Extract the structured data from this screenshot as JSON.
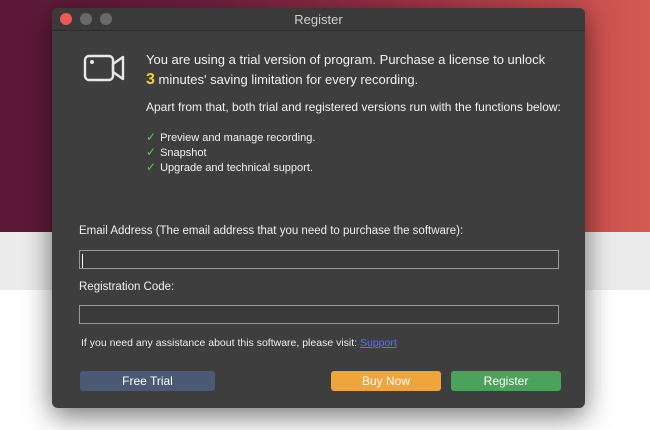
{
  "window": {
    "title": "Register"
  },
  "message": {
    "part1": "You are using a trial version of program. Purchase a license to unlock",
    "highlight": "3",
    "part2": " minutes' saving limitation for every recording."
  },
  "apart_text": "Apart from that, both trial and registered versions run with the functions below:",
  "features": [
    "Preview and manage recording.",
    "Snapshot",
    "Upgrade and technical support."
  ],
  "email": {
    "label": "Email Address (The email address that you need to purchase the software):",
    "value": "",
    "placeholder": ""
  },
  "code": {
    "label": "Registration Code:",
    "value": "",
    "placeholder": ""
  },
  "help": {
    "text": "If you need any assistance about this software, please visit: ",
    "link": "Support"
  },
  "buttons": {
    "free_trial": "Free Trial",
    "buy_now": "Buy Now",
    "register": "Register"
  },
  "icons": {
    "camera": "video-camera-icon",
    "check": "check-icon"
  },
  "colors": {
    "highlight": "#f3d22f",
    "check": "#4fd24f",
    "buy": "#f0a53a",
    "register": "#4aa35a",
    "trial": "#4b5a74",
    "link": "#4a78ff"
  }
}
